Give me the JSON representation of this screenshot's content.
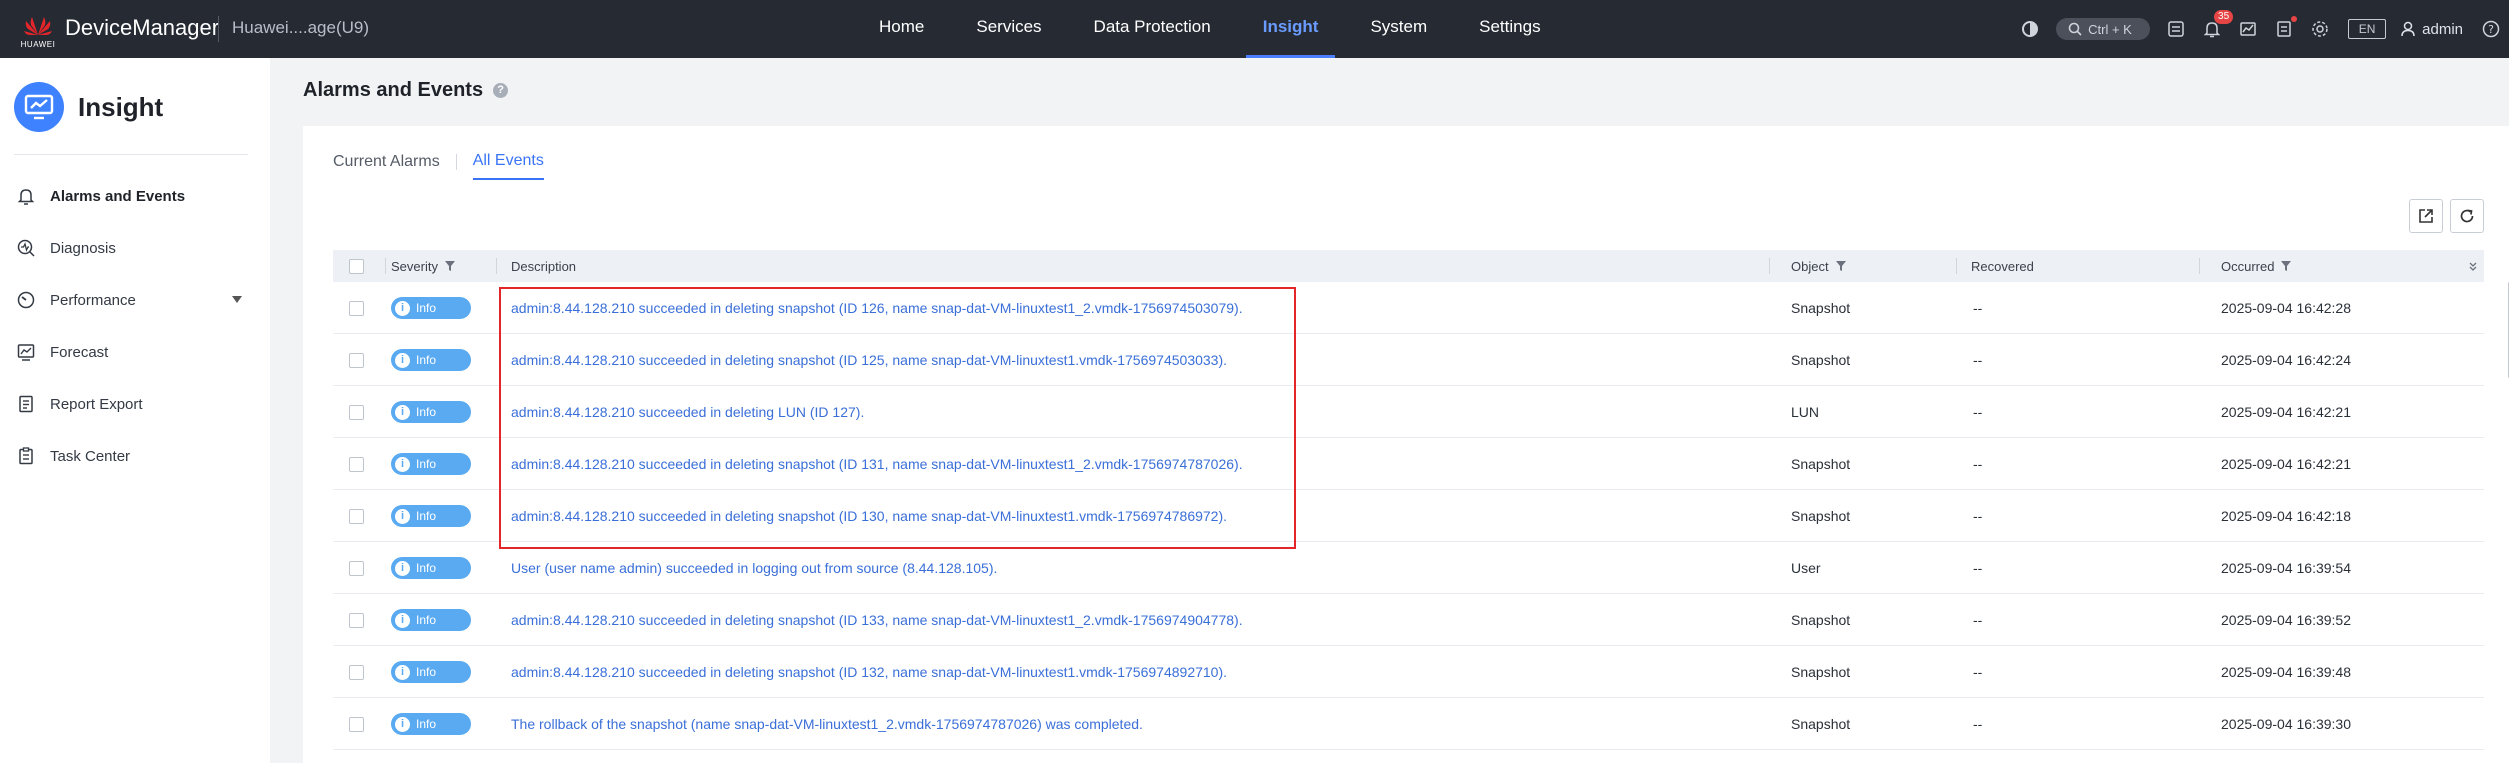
{
  "topbar": {
    "logo_text": "HUAWEI",
    "brand": "DeviceManager",
    "device": "Huawei....age(U9)",
    "nav": [
      {
        "label": "Home",
        "active": false
      },
      {
        "label": "Services",
        "active": false
      },
      {
        "label": "Data Protection",
        "active": false
      },
      {
        "label": "Insight",
        "active": true
      },
      {
        "label": "System",
        "active": false
      },
      {
        "label": "Settings",
        "active": false
      }
    ],
    "search_shortcut": "Ctrl + K",
    "alarm_count": "35",
    "language": "EN",
    "user": "admin"
  },
  "sidebar": {
    "title": "Insight",
    "items": [
      {
        "label": "Alarms and Events",
        "icon": "bell-icon",
        "active": true
      },
      {
        "label": "Diagnosis",
        "icon": "diagnosis-icon",
        "active": false
      },
      {
        "label": "Performance",
        "icon": "gauge-icon",
        "active": false,
        "expandable": true
      },
      {
        "label": "Forecast",
        "icon": "forecast-icon",
        "active": false
      },
      {
        "label": "Report Export",
        "icon": "report-icon",
        "active": false
      },
      {
        "label": "Task Center",
        "icon": "task-icon",
        "active": false
      }
    ]
  },
  "page": {
    "title": "Alarms and Events",
    "help_icon": "?"
  },
  "tabs": [
    {
      "label": "Current Alarms",
      "active": false
    },
    {
      "label": "All Events",
      "active": true
    }
  ],
  "table": {
    "columns": {
      "severity": "Severity",
      "description": "Description",
      "object": "Object",
      "recovered": "Recovered",
      "occurred": "Occurred"
    },
    "rows": [
      {
        "severity": "Info",
        "description": "admin:8.44.128.210 succeeded in deleting snapshot (ID 126, name snap-dat-VM-linuxtest1_2.vmdk-1756974503079).",
        "object": "Snapshot",
        "recovered": "--",
        "occurred": "2025-09-04 16:42:28"
      },
      {
        "severity": "Info",
        "description": "admin:8.44.128.210 succeeded in deleting snapshot (ID 125, name snap-dat-VM-linuxtest1.vmdk-1756974503033).",
        "object": "Snapshot",
        "recovered": "--",
        "occurred": "2025-09-04 16:42:24"
      },
      {
        "severity": "Info",
        "description": "admin:8.44.128.210 succeeded in deleting LUN (ID 127).",
        "object": "LUN",
        "recovered": "--",
        "occurred": "2025-09-04 16:42:21"
      },
      {
        "severity": "Info",
        "description": "admin:8.44.128.210 succeeded in deleting snapshot (ID 131, name snap-dat-VM-linuxtest1_2.vmdk-1756974787026).",
        "object": "Snapshot",
        "recovered": "--",
        "occurred": "2025-09-04 16:42:21"
      },
      {
        "severity": "Info",
        "description": "admin:8.44.128.210 succeeded in deleting snapshot (ID 130, name snap-dat-VM-linuxtest1.vmdk-1756974786972).",
        "object": "Snapshot",
        "recovered": "--",
        "occurred": "2025-09-04 16:42:18"
      },
      {
        "severity": "Info",
        "description": "User (user name admin) succeeded in logging out from source (8.44.128.105).",
        "object": "User",
        "recovered": "--",
        "occurred": "2025-09-04 16:39:54"
      },
      {
        "severity": "Info",
        "description": "admin:8.44.128.210 succeeded in deleting snapshot (ID 133, name snap-dat-VM-linuxtest1_2.vmdk-1756974904778).",
        "object": "Snapshot",
        "recovered": "--",
        "occurred": "2025-09-04 16:39:52"
      },
      {
        "severity": "Info",
        "description": "admin:8.44.128.210 succeeded in deleting snapshot (ID 132, name snap-dat-VM-linuxtest1.vmdk-1756974892710).",
        "object": "Snapshot",
        "recovered": "--",
        "occurred": "2025-09-04 16:39:48"
      },
      {
        "severity": "Info",
        "description": "The rollback of the snapshot (name snap-dat-VM-linuxtest1_2.vmdk-1756974787026) was completed.",
        "object": "Snapshot",
        "recovered": "--",
        "occurred": "2025-09-04 16:39:30"
      }
    ]
  },
  "colors": {
    "topbar": "#262a33",
    "accent": "#3a74f6",
    "info_badge": "#5aaaf2",
    "highlight_box": "#e4262b"
  }
}
